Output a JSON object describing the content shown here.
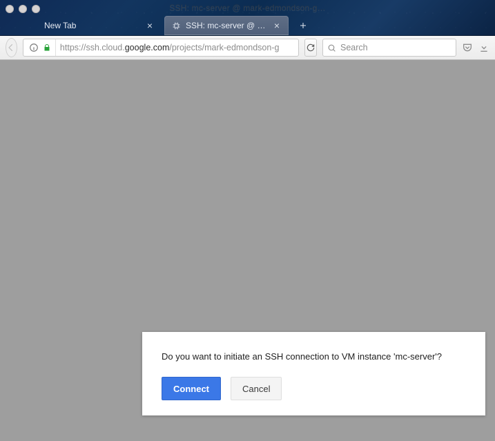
{
  "window": {
    "ghost_title": "SSH: mc-server @ mark-edmondson-g…"
  },
  "tabs": [
    {
      "label": "New Tab",
      "active": false
    },
    {
      "label": "SSH: mc-server @ mark-ed…",
      "active": true
    }
  ],
  "address_bar": {
    "scheme": "https://",
    "subdomain": "ssh.cloud.",
    "domain": "google.com",
    "path": "/projects/mark-edmondson-g"
  },
  "search": {
    "placeholder": "Search"
  },
  "dialog": {
    "message": "Do you want to initiate an SSH connection to VM instance 'mc-server'?",
    "connect_label": "Connect",
    "cancel_label": "Cancel"
  }
}
